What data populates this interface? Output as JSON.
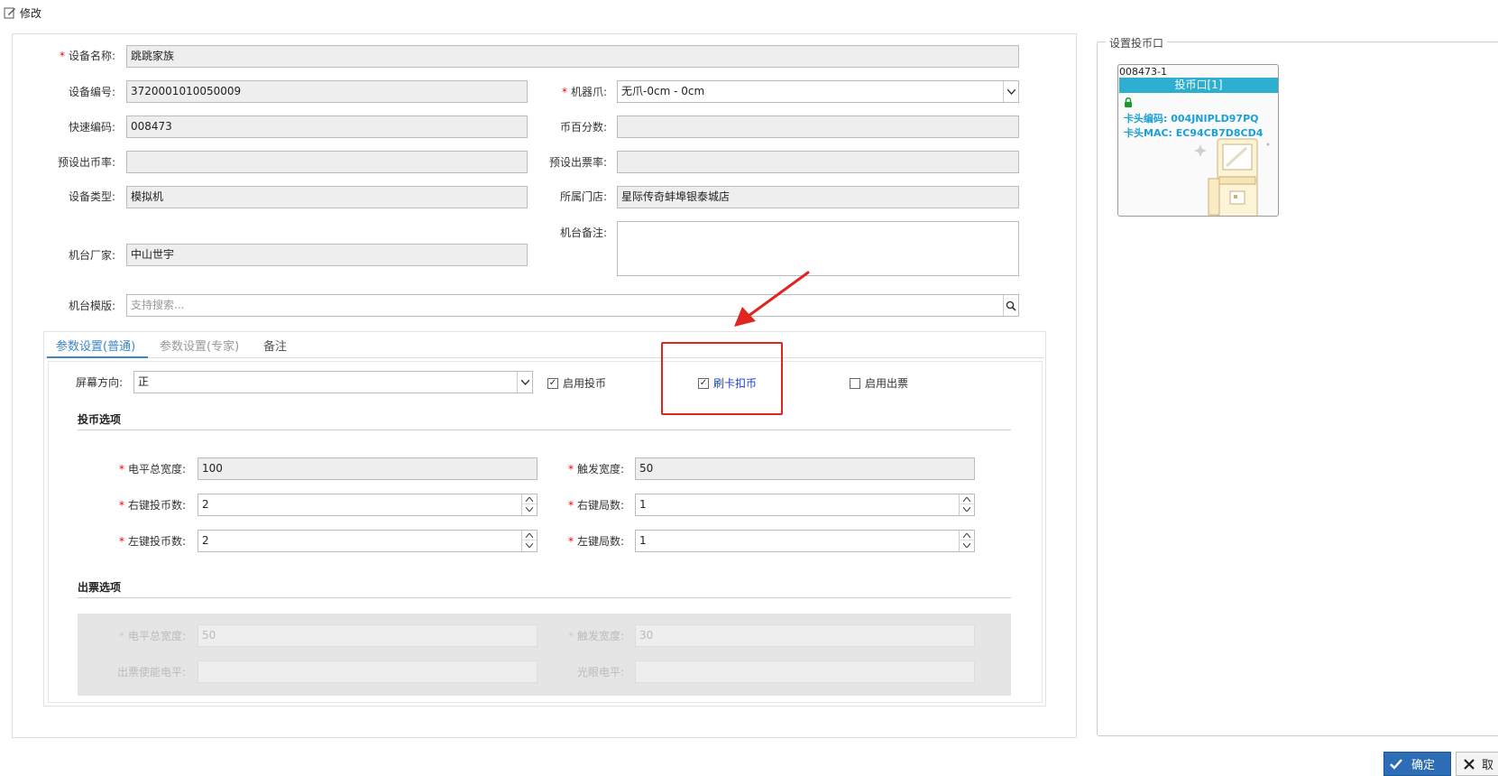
{
  "window": {
    "title": "修改",
    "edit_icon": "edit-icon"
  },
  "form": {
    "device_name_label": "设备名称:",
    "device_name_value": "跳跳家族",
    "device_code_label": "设备编号:",
    "device_code_value": "3720001010050009",
    "claw_label": "机器爪:",
    "claw_value": "无爪-0cm - 0cm",
    "quick_code_label": "快速编码:",
    "quick_code_value": "008473",
    "coin_percent_label": "币百分数:",
    "coin_percent_value": "",
    "preset_coin_rate_label": "预设出币率:",
    "preset_coin_rate_value": "",
    "preset_ticket_rate_label": "预设出票率:",
    "preset_ticket_rate_value": "",
    "device_type_label": "设备类型:",
    "device_type_value": "模拟机",
    "store_label": "所属门店:",
    "store_value": "星际传奇蚌埠银泰城店",
    "manufacturer_label": "机台厂家:",
    "manufacturer_value": "中山世宇",
    "remark_label": "机台备注:",
    "remark_value": "",
    "template_label": "机台模版:",
    "template_placeholder": "支持搜索..."
  },
  "tabs": [
    "参数设置(普通)",
    "参数设置(专家)",
    "备注"
  ],
  "params": {
    "screen_dir_label": "屏幕方向:",
    "screen_dir_value": "正",
    "enable_coin_label": "启用投币",
    "enable_coin_checked": true,
    "card_deduct_label": "刷卡扣币",
    "card_deduct_checked": true,
    "enable_ticket_label": "启用出票",
    "enable_ticket_checked": false,
    "coin_section_title": "投币选项",
    "coin_level_width_label": "电平总宽度:",
    "coin_level_width_value": "100",
    "coin_trigger_width_label": "触发宽度:",
    "coin_trigger_width_value": "50",
    "right_key_coins_label": "右键投币数:",
    "right_key_coins_value": "2",
    "right_key_rounds_label": "右键局数:",
    "right_key_rounds_value": "1",
    "left_key_coins_label": "左键投币数:",
    "left_key_coins_value": "2",
    "left_key_rounds_label": "左键局数:",
    "left_key_rounds_value": "1",
    "ticket_section_title": "出票选项",
    "ticket_level_width_label": "电平总宽度:",
    "ticket_level_width_value": "50",
    "ticket_trigger_width_label": "触发宽度:",
    "ticket_trigger_width_value": "30",
    "ticket_enable_level_label": "出票使能电平:",
    "ticket_enable_level_value": "",
    "optical_level_label": "光眼电平:",
    "optical_level_value": ""
  },
  "right_panel": {
    "legend": "设置投币口",
    "card_id": "008473-1",
    "card_header": "投币口[1]",
    "card_code_line": "卡头编码: 004JNIPLD97PQ",
    "card_mac_line": "卡头MAC: EC94CB7D8CD4"
  },
  "buttons": {
    "ok": "确定",
    "cancel": "取"
  },
  "colors": {
    "accent": "#2c6db5",
    "tab_active": "#3a87c8",
    "card_header": "#2eaed0",
    "highlight_box": "#e0241f",
    "required": "#e00000"
  }
}
